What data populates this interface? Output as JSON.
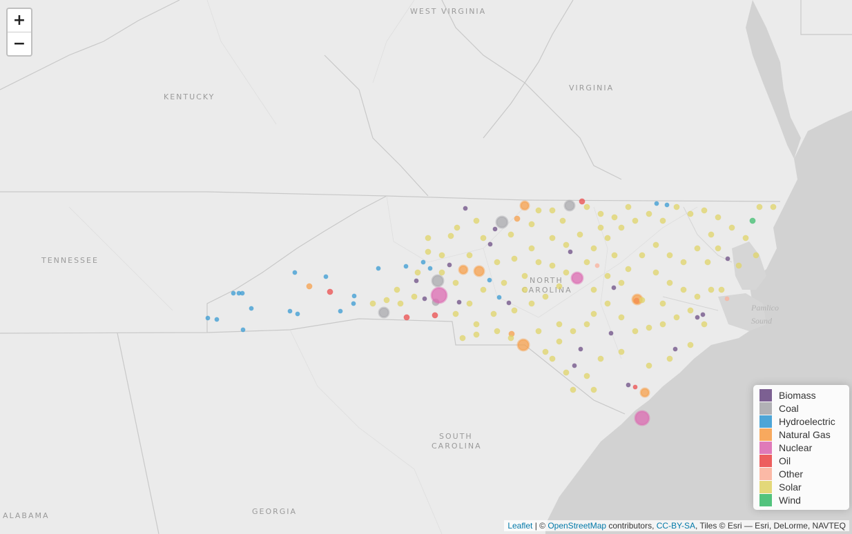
{
  "zoom": {
    "in_label": "+",
    "out_label": "−"
  },
  "labels": {
    "west_virginia": "WEST VIRGINIA",
    "kentucky": "KENTUCKY",
    "virginia": "VIRGINIA",
    "tennessee": "TENNESSEE",
    "north": "NORTH",
    "carolina": "CAROLINA",
    "pamlico": "Pamlico",
    "sound": "Sound",
    "south": "SOUTH",
    "carolina_sc": "CAROLINA",
    "alabama": "ALABAMA",
    "georgia": "GEORGIA"
  },
  "legend": {
    "items": [
      {
        "label": "Biomass",
        "color": "#6e4f86"
      },
      {
        "label": "Coal",
        "color": "#a9a9ad"
      },
      {
        "label": "Hydroelectric",
        "color": "#3a9bd3"
      },
      {
        "label": "Natural Gas",
        "color": "#f7a04c"
      },
      {
        "label": "Nuclear",
        "color": "#dc6bb1"
      },
      {
        "label": "Oil",
        "color": "#eb4d4d"
      },
      {
        "label": "Other",
        "color": "#fbb19c"
      },
      {
        "label": "Solar",
        "color": "#e0d46a"
      },
      {
        "label": "Wind",
        "color": "#3fbd6f"
      }
    ]
  },
  "attribution": {
    "leaflet": "Leaflet",
    "sep1": " | © ",
    "osm": "OpenStreetMap",
    "contributors": " contributors, ",
    "license": "CC-BY-SA",
    "tiles": ", Tiles © Esri — Esri, DeLorme, NAVTEQ"
  }
}
